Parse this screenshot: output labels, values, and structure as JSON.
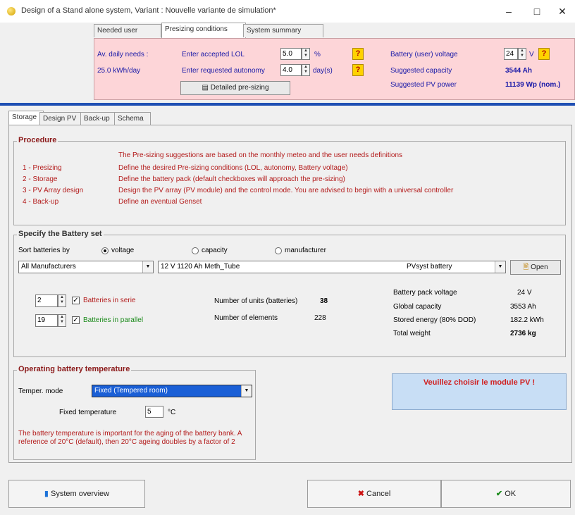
{
  "window": {
    "title": "Design of a Stand alone system, Variant : Nouvelle variante de simulation*",
    "min": "–",
    "max": "□",
    "close": "✕"
  },
  "top_tabs": [
    "Needed user",
    "Presizing conditions",
    "System summary"
  ],
  "presizing": {
    "av_daily_needs_label": "Av. daily needs :",
    "av_daily_needs_value": "25.0 kWh/day",
    "lol_label": "Enter accepted LOL",
    "lol_value": "5.0",
    "lol_unit": "%",
    "autonomy_label": "Enter requested autonomy",
    "autonomy_value": "4.0",
    "autonomy_unit": "day(s)",
    "battery_voltage_label": "Battery (user) voltage",
    "battery_voltage_value": "24",
    "battery_voltage_unit": "V",
    "suggested_capacity_label": "Suggested capacity",
    "suggested_capacity_value": "3544 Ah",
    "suggested_power_label": "Suggested PV power",
    "suggested_power_value": "11139 Wp (nom.)",
    "detailed_presizing_button": "Detailed pre-sizing",
    "help_symbol": "?"
  },
  "sub_tabs": [
    "Storage",
    "Design PV",
    "Back-up",
    "Schema"
  ],
  "procedure": {
    "title": "Procedure",
    "intro": "The Pre-sizing suggestions are based on the monthly meteo and the user needs definitions",
    "steps": [
      {
        "label": "1 - Presizing",
        "text": "Define the desired Pre-sizing conditions (LOL, autonomy, Battery voltage)"
      },
      {
        "label": "2 - Storage",
        "text": "Define the battery pack (default checkboxes will approach the pre-sizing)"
      },
      {
        "label": "3 - PV Array design",
        "text": "Design the PV array (PV module) and the control mode. You are advised to begin with a universal controller"
      },
      {
        "label": "4 - Back-up",
        "text": "Define an eventual Genset"
      }
    ]
  },
  "battery_set": {
    "title": "Specify the Battery set",
    "sort_label": "Sort batteries by",
    "sort_options": [
      "voltage",
      "capacity",
      "manufacturer"
    ],
    "manufacturer_combo": "All Manufacturers",
    "battery_combo": "12 V       1120 Ah       Meth_Tube",
    "battery_source": "PVsyst battery",
    "open_button": "Open",
    "in_series_value": "2",
    "in_series_label": "Batteries in serie",
    "in_parallel_value": "19",
    "in_parallel_label": "Batteries in parallel",
    "n_units_label": "Number of units (batteries)",
    "n_units_value": "38",
    "n_elements_label": "Number of elements",
    "n_elements_value": "228",
    "pack_voltage_label": "Battery pack voltage",
    "pack_voltage_value": "24 V",
    "global_capacity_label": "Global capacity",
    "global_capacity_value": "3553 Ah",
    "stored_energy_label": "Stored energy (80% DOD)",
    "stored_energy_value": "182.2 kWh",
    "total_weight_label": "Total weight",
    "total_weight_value": "2736 kg"
  },
  "temperature": {
    "title": "Operating battery temperature",
    "mode_label": "Temper. mode",
    "mode_value": "Fixed (Tempered room)",
    "fixed_label": "Fixed temperature",
    "fixed_value": "5",
    "fixed_unit": "°C",
    "warning": "The battery temperature is important for the aging of the battery bank. A reference of 20°C (default), then 20°C ageing doubles by a factor of 2"
  },
  "module_check": "Veuillez choisir le module PV !",
  "buttons": {
    "system_overview": "System overview",
    "cancel": "Cancel",
    "ok": "OK"
  }
}
